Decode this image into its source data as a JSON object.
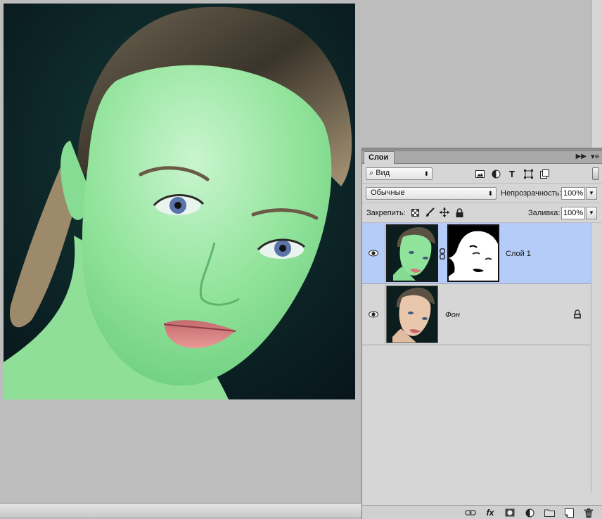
{
  "document": {
    "image_alt": "portrait"
  },
  "layers_panel": {
    "tab_label": "Слои",
    "filter": {
      "kind_label": "Вид",
      "icons": [
        "image-filter-icon",
        "adjustment-filter-icon",
        "type-filter-icon",
        "shape-filter-icon",
        "smart-object-filter-icon"
      ]
    },
    "blend_mode": "Обычные",
    "opacity_label": "Непрозрачность:",
    "opacity_value": "100%",
    "lock_label": "Закрепить:",
    "fill_label": "Заливка:",
    "fill_value": "100%",
    "layers": [
      {
        "name": "Слой 1",
        "selected": true,
        "has_mask": true,
        "locked": false
      },
      {
        "name": "Фон",
        "selected": false,
        "has_mask": false,
        "locked": true
      }
    ],
    "bottom_icons": [
      "link-layers-icon",
      "fx-icon",
      "add-mask-icon",
      "adjustment-layer-icon",
      "new-group-icon",
      "new-layer-icon",
      "delete-layer-icon"
    ],
    "fx_label": "fx"
  },
  "colors": {
    "selected_layer": "#b5cbf8",
    "panel_bg": "#d6d6d6",
    "canvas_bg": "#bdbdbd",
    "skin_tint": "#8fe49a"
  }
}
